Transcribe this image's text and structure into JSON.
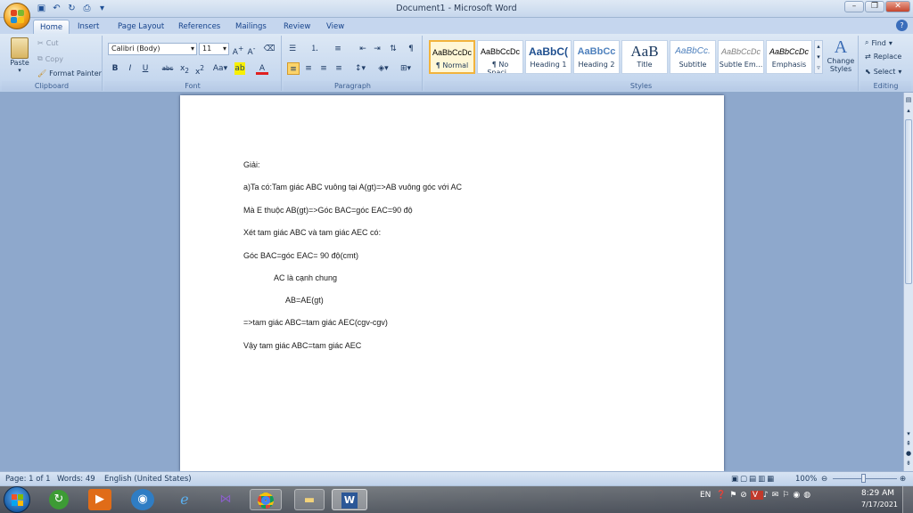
{
  "window": {
    "title": "Document1 - Microsoft Word",
    "min": "–",
    "max": "❐",
    "close": "✕",
    "help": "?"
  },
  "tabs": [
    "Home",
    "Insert",
    "Page Layout",
    "References",
    "Mailings",
    "Review",
    "View"
  ],
  "clipboard": {
    "paste": "Paste",
    "cut": "Cut",
    "copy": "Copy",
    "format_painter": "Format Painter",
    "label": "Clipboard"
  },
  "font": {
    "name": "Calibri (Body)",
    "size": "11",
    "label": "Font"
  },
  "paragraph": {
    "label": "Paragraph"
  },
  "styles": {
    "label": "Styles",
    "change_styles": "Change Styles",
    "items": [
      {
        "sample": "AaBbCcDc",
        "name": "¶ Normal"
      },
      {
        "sample": "AaBbCcDc",
        "name": "¶ No Spaci..."
      },
      {
        "sample": "AaBbC(",
        "name": "Heading 1"
      },
      {
        "sample": "AaBbCc",
        "name": "Heading 2"
      },
      {
        "sample": "AaB",
        "name": "Title"
      },
      {
        "sample": "AaBbCc.",
        "name": "Subtitle"
      },
      {
        "sample": "AaBbCcDc",
        "name": "Subtle Em..."
      },
      {
        "sample": "AaBbCcDc",
        "name": "Emphasis"
      }
    ]
  },
  "editing": {
    "find": "Find",
    "replace": "Replace",
    "select": "Select",
    "label": "Editing"
  },
  "document": {
    "lines": [
      "Giải:",
      "a)Ta có:Tam giác ABC vuông tại A(gt)=>AB vuông góc với AC",
      "Mà E thuộc AB(gt)=>Góc BAC=góc EAC=90 độ",
      "Xét tam giác ABC và tam giác AEC có:",
      "Góc BAC=góc EAC= 90 độ(cmt)",
      "AC là cạnh chung",
      "AB=AE(gt)",
      "=>tam giác ABC=tam giác AEC(cgv-cgv)",
      "Vậy tam giác ABC=tam giác AEC"
    ]
  },
  "status": {
    "page": "Page: 1 of 1",
    "words": "Words: 49",
    "language": "English (United States)",
    "zoom": "100%"
  },
  "tray": {
    "lang": "EN",
    "time": "8:29 AM",
    "date": "7/17/2021"
  }
}
